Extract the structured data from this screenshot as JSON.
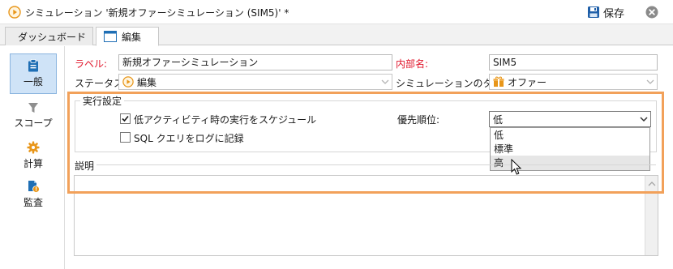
{
  "titlebar": {
    "title": "シミュレーション '新規オファーシミュレーション (SIM5)' *",
    "save_label": "保存",
    "icons": {
      "title": "play-circle-icon",
      "save": "floppy-disk-icon",
      "close": "close-circle-icon"
    }
  },
  "tabs": [
    {
      "label": "ダッシュボード",
      "icon": "play-circle-icon",
      "active": false
    },
    {
      "label": "編集",
      "icon": "window-icon",
      "active": true
    }
  ],
  "sidebar": {
    "items": [
      {
        "label": "一般",
        "icon": "clipboard-icon",
        "selected": true
      },
      {
        "label": "スコープ",
        "icon": "funnel-icon",
        "selected": false
      },
      {
        "label": "計算",
        "icon": "gear-icon",
        "selected": false
      },
      {
        "label": "監査",
        "icon": "audit-icon",
        "selected": false
      }
    ]
  },
  "form": {
    "label_label": "ラベル:",
    "label_value": "新規オファーシミュレーション",
    "internal_label": "内部名:",
    "internal_value": "SIM5",
    "status_label": "ステータス:",
    "status_value": "編集",
    "sim_type_label": "シミュレーションのタイプ:",
    "sim_type_value": "オファー"
  },
  "execution": {
    "group_title": "実行設定",
    "schedule_label": "低アクティビティ時の実行をスケジュール",
    "schedule_checked": true,
    "sql_label": "SQL クエリをログに記録",
    "sql_checked": false,
    "priority_label": "優先順位:",
    "priority_value": "低",
    "priority_options": [
      "低",
      "標準",
      "高"
    ],
    "hovered_option": "高"
  },
  "description": {
    "label": "説明",
    "value": ""
  },
  "colors": {
    "required_label": "#e0162b",
    "highlight_border": "#f2a15a",
    "selected_side_bg": "#cfe3f7",
    "accent_blue": "#1f6fb5",
    "accent_orange": "#e8961a"
  }
}
